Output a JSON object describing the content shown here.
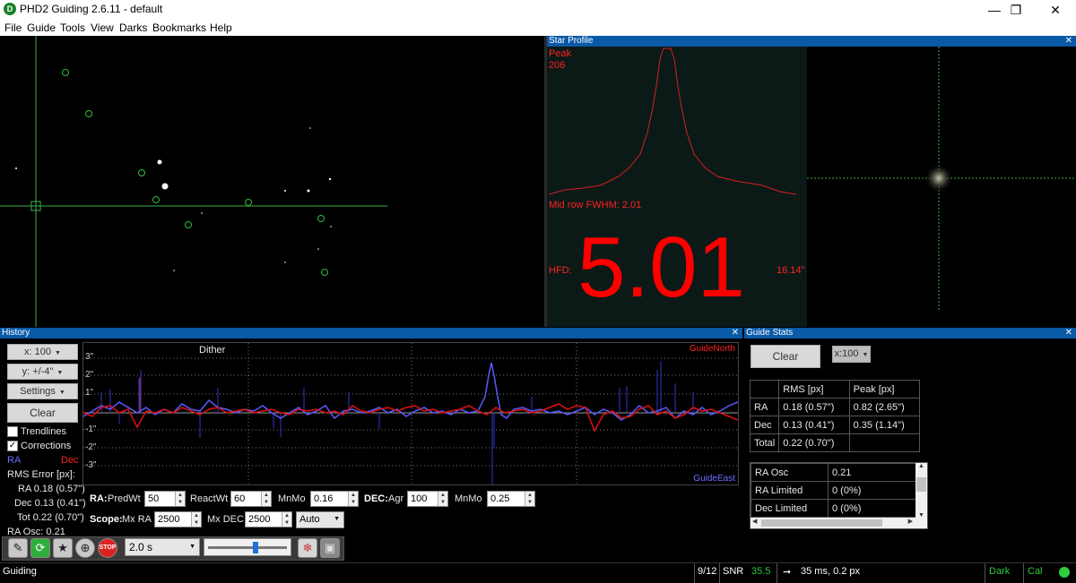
{
  "window": {
    "title": "PHD2 Guiding 2.6.11 - default",
    "icon_glyph": "D",
    "controls": [
      "minimize-icon",
      "restore-icon",
      "close-icon"
    ]
  },
  "menu": [
    "File",
    "Guide",
    "Tools",
    "View",
    "Darks",
    "Bookmarks",
    "Help"
  ],
  "star_profile": {
    "header": "Star Profile",
    "peak_label": "Peak",
    "peak_value": "206",
    "fwhm_text": "Mid row FWHM: 2.01",
    "hfd_label": "HFD:",
    "hfd_value": "5.01",
    "hfd_arcsec": "16.14\""
  },
  "history": {
    "header": "History",
    "x_scale": "x: 100",
    "y_scale": "y: +/-4\"",
    "settings_label": "Settings",
    "clear_label": "Clear",
    "trendlines_label": "Trendlines",
    "trendlines_checked": false,
    "corrections_label": "Corrections",
    "corrections_checked": true,
    "legend_ra": "RA",
    "legend_dec": "Dec",
    "rms_title": "RMS Error [px]:",
    "rms_ra": "RA 0.18 (0.57\")",
    "rms_dec": "Dec 0.13 (0.41\")",
    "rms_tot": "Tot 0.22 (0.70\")",
    "ra_osc": "RA Osc: 0.21",
    "dither_label": "Dither",
    "guide_north": "GuideNorth",
    "guide_east": "GuideEast",
    "y_ticks": [
      "3\"",
      "2\"",
      "1\"",
      "-1\"",
      "-2\"",
      "-3\""
    ],
    "ra_label": "RA:",
    "predwt_label": "PredWt",
    "predwt_value": "50",
    "reactwt_label": "ReactWt",
    "reactwt_value": "60",
    "mnmo_label": "MnMo",
    "ra_mnmo_value": "0.16",
    "dec_label": "DEC:",
    "agr_label": "Agr",
    "agr_value": "100",
    "dec_mnmo_value": "0.25",
    "scope_label": "Scope:",
    "mxra_label": "Mx RA",
    "mxra_value": "2500",
    "mxdec_label": "Mx DEC",
    "mxdec_value": "2500",
    "dec_mode": "Auto"
  },
  "guide_stats": {
    "header": "Guide Stats",
    "clear_label": "Clear",
    "x_scale": "x:100",
    "col_headers": [
      "",
      "RMS [px]",
      "Peak [px]"
    ],
    "rows": [
      [
        "RA",
        "0.18 (0.57\")",
        "0.82 (2.65\")"
      ],
      [
        "Dec",
        "0.13 (0.41\")",
        "0.35 (1.14\")"
      ],
      [
        "Total",
        "0.22 (0.70\")",
        ""
      ]
    ],
    "osc_rows": [
      [
        "RA Osc",
        "0.21"
      ],
      [
        "RA Limited",
        "0 (0%)"
      ],
      [
        "Dec Limited",
        "0 (0%)"
      ]
    ]
  },
  "toolbar": {
    "exposure": "2.0 s",
    "icons": [
      "pencil-icon",
      "loop-icon",
      "star-icon",
      "crosshair-icon",
      "stop-icon",
      "brain-icon",
      "camera-icon"
    ]
  },
  "status": {
    "text": "Guiding",
    "frame": "9/12",
    "snr_label": "SNR",
    "snr_value": "35.5",
    "guide_info": "35 ms, 0.2 px",
    "dark_label": "Dark",
    "cal_label": "Cal",
    "colors": {
      "green": "#2ecc40",
      "red": "#ff0000",
      "blue": "#5050ff"
    }
  }
}
